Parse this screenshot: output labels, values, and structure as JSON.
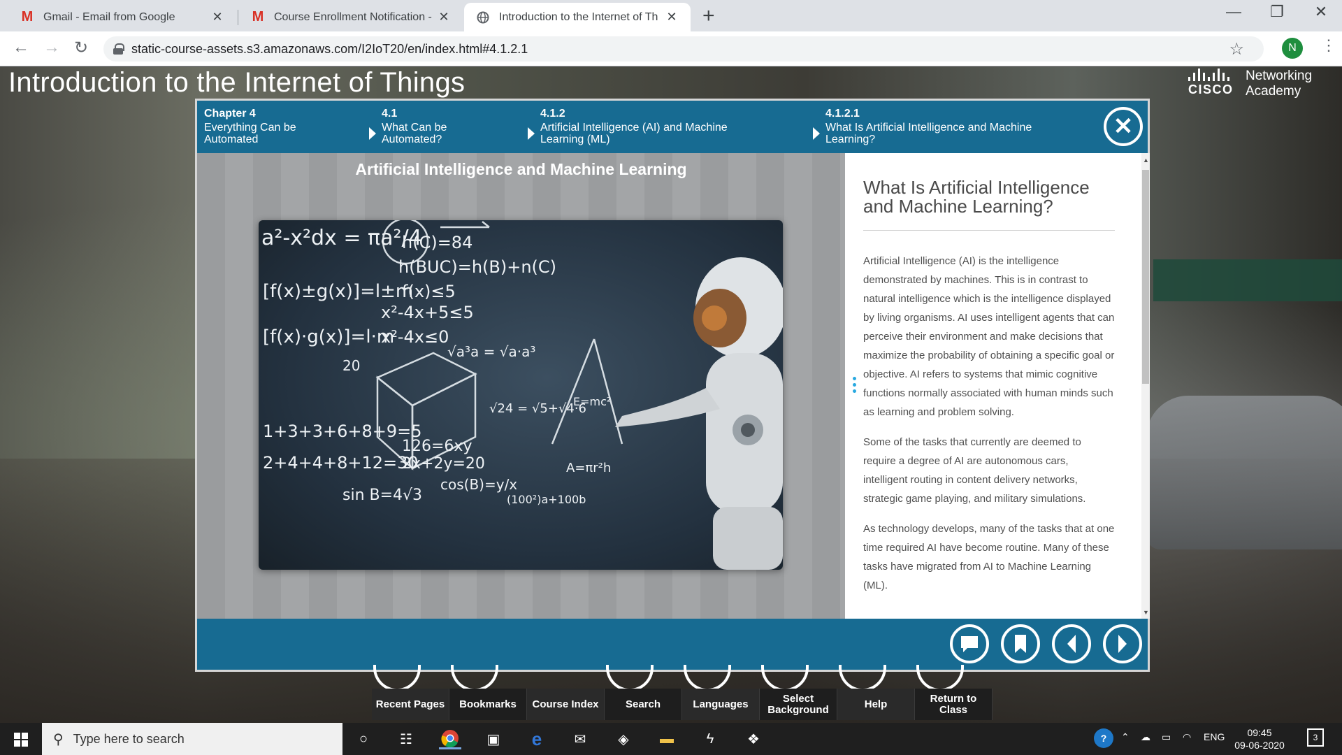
{
  "browser": {
    "tabs": [
      {
        "title": "Gmail - Email from Google",
        "icon": "gmail-icon"
      },
      {
        "title": "Course Enrollment Notification -",
        "icon": "gmail-icon"
      },
      {
        "title": "Introduction to the Internet of Th",
        "icon": "globe-icon"
      }
    ],
    "url": "static-course-assets.s3.amazonaws.com/I2IoT20/en/index.html#4.1.2.1",
    "profile_initial": "N"
  },
  "page": {
    "course_title": "Introduction to the Internet of Things",
    "logo": {
      "brand": "CISCO",
      "line1": "Networking",
      "line2": "Academy"
    }
  },
  "modal": {
    "breadcrumbs": [
      {
        "num": "Chapter 4",
        "label": "Everything Can be Automated"
      },
      {
        "num": "4.1",
        "label": "What Can be Automated?"
      },
      {
        "num": "4.1.2",
        "label": "Artificial Intelligence (AI) and Machine Learning (ML)"
      },
      {
        "num": "4.1.2.1",
        "label": "What Is Artificial Intelligence and Machine Learning?"
      }
    ],
    "slide_title": "Artificial Intelligence and Machine Learning",
    "content": {
      "heading": "What Is Artificial Intelligence and Machine Learning?",
      "paragraphs": [
        "Artificial Intelligence (AI) is the intelligence demonstrated by machines. This is in contrast to natural intelligence which is the intelligence displayed by living organisms. AI uses intelligent agents that can perceive their environment and make decisions that maximize the probability of obtaining a specific goal or objective. AI refers to systems that mimic cognitive functions normally associated with human minds such as learning and problem solving.",
        "Some of the tasks that currently are deemed to require a degree of AI are autonomous cars, intelligent routing in content delivery networks, strategic game playing, and military simulations.",
        "As technology develops, many of the tasks that at one time required AI have become routine. Many of these tasks have migrated from AI to Machine Learning (ML)."
      ]
    },
    "chalkboard": [
      "a²-x²dx = πa²/4",
      "h(C)=84",
      "h(BUC)=h(B)+n(C)",
      "[f(x)±g(x)]=l±m",
      "f(x)≤5",
      "x²-4x+5≤5",
      "[f(x)·g(x)]=l·m",
      "x²-4x≤0",
      "√a³a = √a·a³",
      "1+3+3+6+8+9=5",
      "126=6xy",
      "2+4+4+8+12=30",
      "2x+2y=20",
      "sin B=4√3",
      "cos(B)=y/x",
      "(100²)a+100b",
      "E=mc²",
      "√24 = √5+√4·6",
      "A=πr²h",
      "20"
    ]
  },
  "course_toolbar": [
    "Recent Pages",
    "Bookmarks",
    "Course Index",
    "Search",
    "Languages",
    "Select Background",
    "Help",
    "Return to Class"
  ],
  "taskbar": {
    "search_placeholder": "Type here to search",
    "language": "ENG",
    "time": "09:45",
    "date": "09-06-2020",
    "notifications": "3"
  },
  "colors": {
    "header_blue": "#176b92",
    "modal_border": "#d6d6d6",
    "accent_dots": "#29a9e0"
  }
}
